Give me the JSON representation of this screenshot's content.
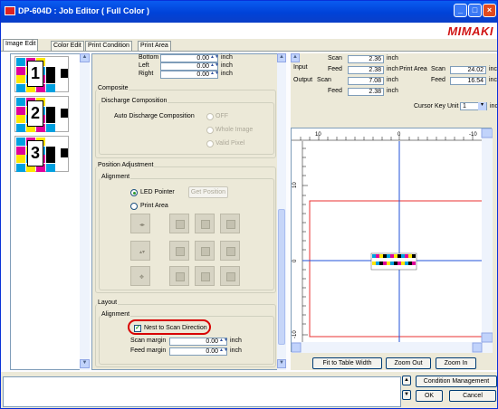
{
  "window": {
    "title": "DP-604D : Job Editor ( Full Color )",
    "brand": "MIMAKI"
  },
  "tabs": [
    "Image Edit",
    "Color Edit",
    "Print Condition",
    "Print Area"
  ],
  "thumbnails": [
    {
      "num": "1"
    },
    {
      "num": "2"
    },
    {
      "num": "3"
    }
  ],
  "margins": {
    "bottom_label": "Bottom",
    "bottom_value": "0.00",
    "left_label": "Left",
    "left_value": "0.00",
    "right_label": "Right",
    "right_value": "0.00",
    "unit": "inch"
  },
  "composite": {
    "title": "Composite",
    "discharge_group": "Discharge Composition",
    "auto_label": "Auto Discharge Composition",
    "off": "OFF",
    "whole": "Whole Image",
    "valid": "Valid Pixel"
  },
  "position": {
    "title": "Position Adjustment",
    "alignment": "Alignment",
    "led": "LED Pointer",
    "print_area": "Print Area",
    "get_position": "Get Position"
  },
  "layout": {
    "title": "Layout",
    "alignment": "Alignment",
    "nest": "Nest to Scan Direction",
    "scan_margin_label": "Scan margin",
    "scan_margin_value": "0.00",
    "feed_margin_label": "Feed margin",
    "feed_margin_value": "0.00",
    "unit": "inch"
  },
  "sizes": {
    "input_label": "Input",
    "scan_label": "Scan",
    "feed_label": "Feed",
    "output_label": "Output",
    "input_scan": "2.36",
    "input_feed": "2.38",
    "output_scan": "7.08",
    "output_feed": "2.38",
    "print_area_label": "Print Area",
    "pa_scan_label": "Scan",
    "pa_feed_label": "Feed",
    "pa_scan": "24.02",
    "pa_feed": "16.54",
    "unit": "inch"
  },
  "cursor_key": {
    "label": "Cursor Key Unit",
    "value": "1",
    "unit": "inch"
  },
  "ruler": {
    "top_labels": [
      "10",
      "0",
      "-10"
    ],
    "side_labels": [
      "10",
      "0",
      "-10"
    ]
  },
  "buttons": {
    "fit": "Fit to Table Width",
    "zoom_out": "Zoom Out",
    "zoom_in": "Zoom In",
    "condition": "Condition Management",
    "ok": "OK",
    "cancel": "Cancel"
  },
  "colors": {
    "accent_red": "#d80000",
    "guide_blue": "#2250d8",
    "area_red": "#e83030"
  }
}
